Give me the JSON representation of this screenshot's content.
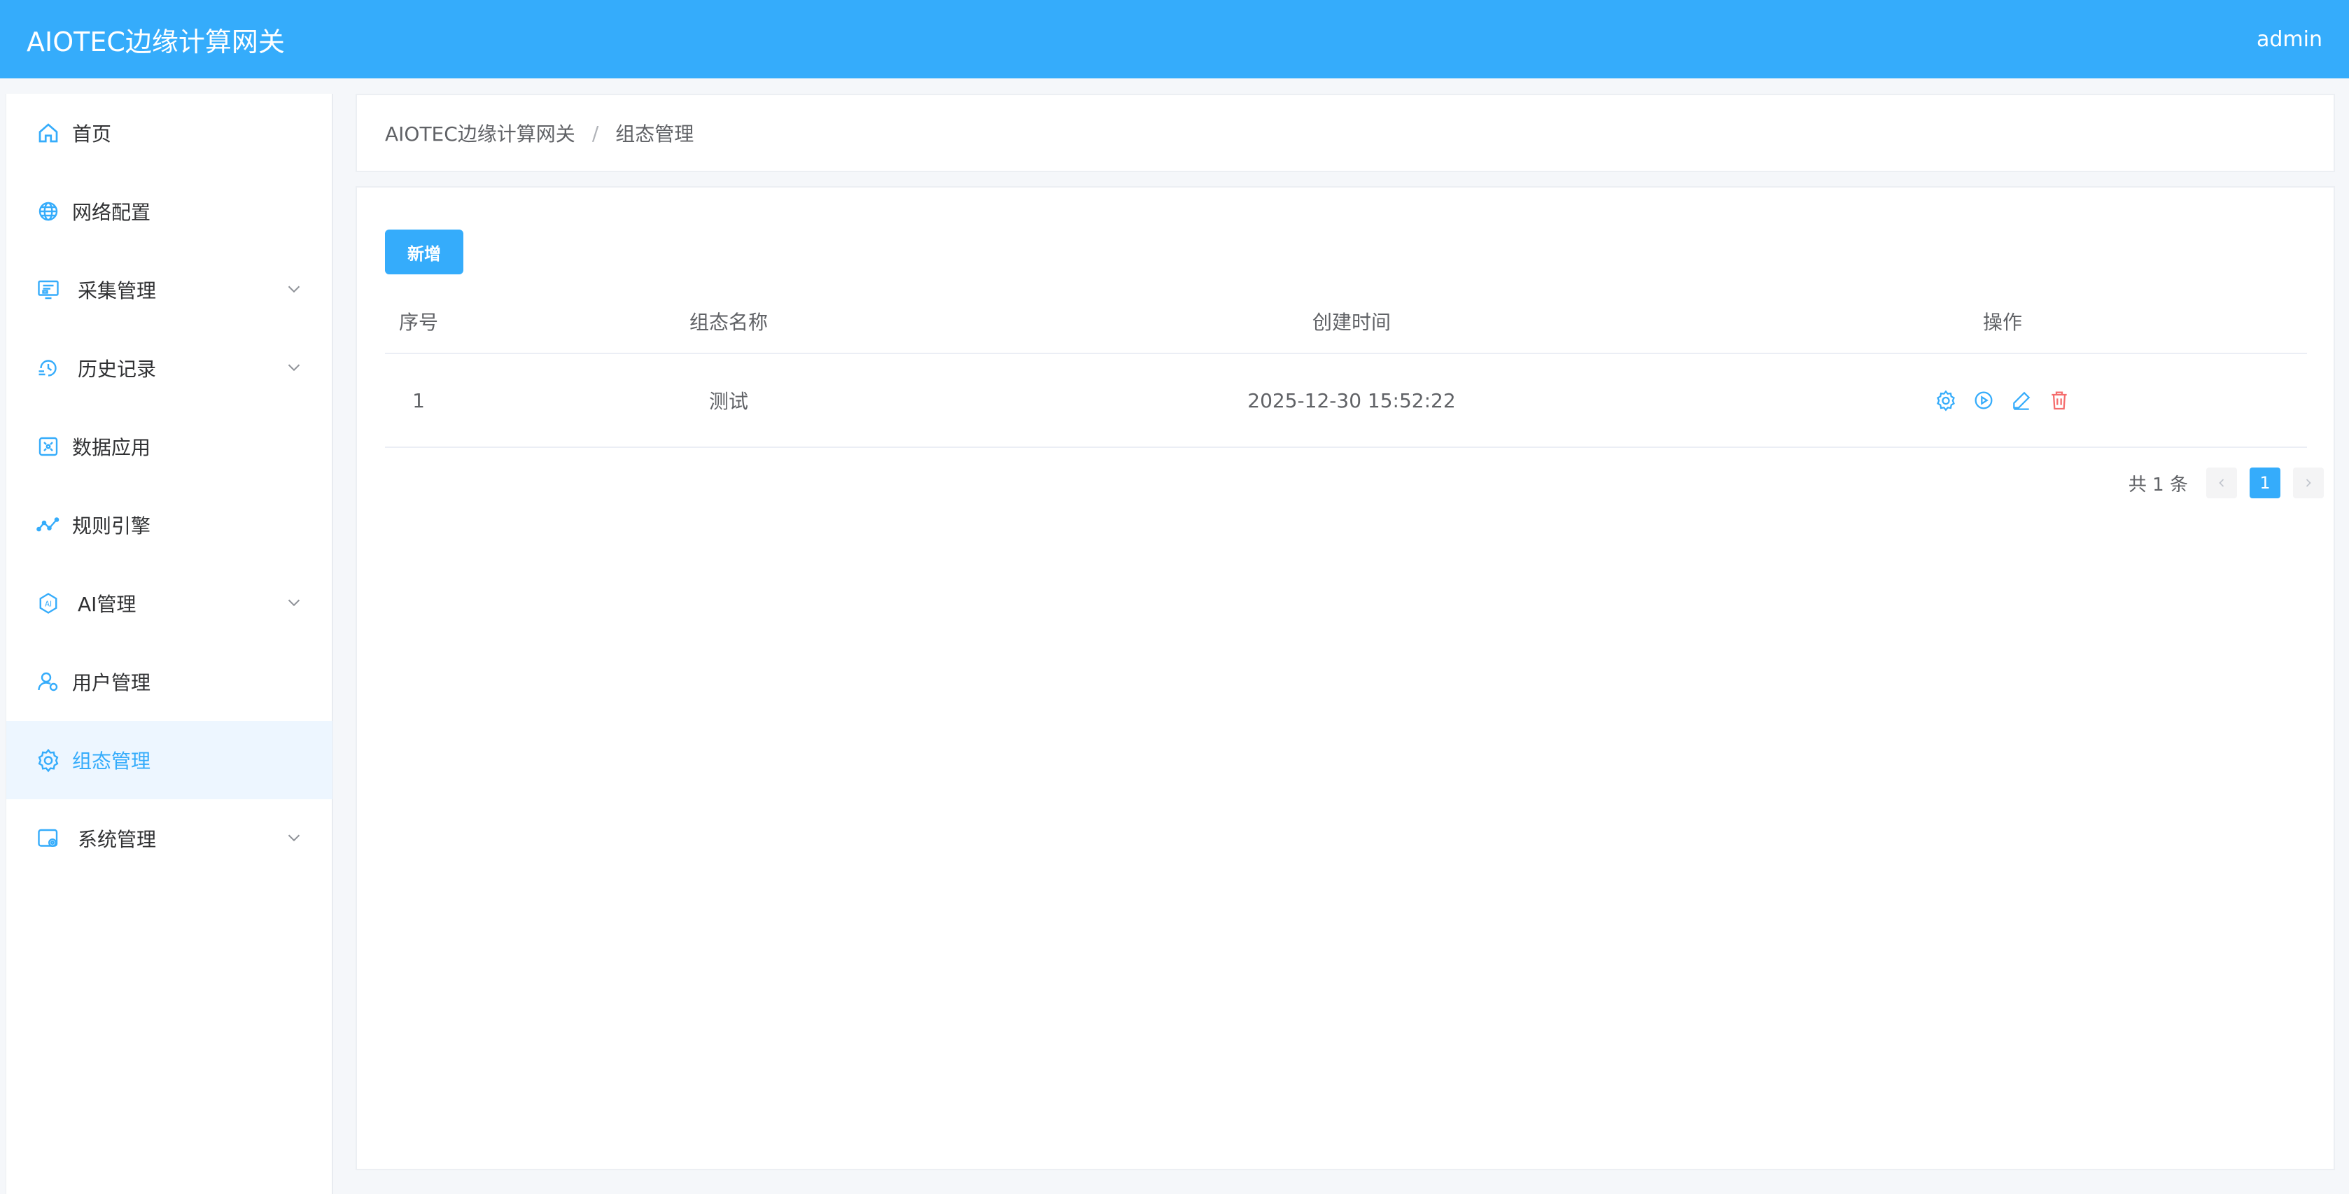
{
  "header": {
    "app_title": "AIOTEC边缘计算网关",
    "user": "admin"
  },
  "sidebar": {
    "items": [
      {
        "label": "首页",
        "icon": "home-icon",
        "expandable": false
      },
      {
        "label": "网络配置",
        "icon": "globe-icon",
        "expandable": false
      },
      {
        "label": "采集管理",
        "icon": "monitor-icon",
        "expandable": true
      },
      {
        "label": "历史记录",
        "icon": "history-icon",
        "expandable": true
      },
      {
        "label": "数据应用",
        "icon": "data-app-icon",
        "expandable": false
      },
      {
        "label": "规则引擎",
        "icon": "rule-graph-icon",
        "expandable": false
      },
      {
        "label": "AI管理",
        "icon": "ai-icon",
        "expandable": true
      },
      {
        "label": "用户管理",
        "icon": "user-icon",
        "expandable": false
      },
      {
        "label": "组态管理",
        "icon": "gear-icon",
        "expandable": false,
        "active": true
      },
      {
        "label": "系统管理",
        "icon": "system-icon",
        "expandable": true
      }
    ]
  },
  "breadcrumb": {
    "root": "AIOTEC边缘计算网关",
    "separator": "/",
    "current": "组态管理"
  },
  "toolbar": {
    "add_label": "新增"
  },
  "table": {
    "columns": [
      "序号",
      "组态名称",
      "创建时间",
      "操作"
    ],
    "rows": [
      {
        "index": "1",
        "name": "测试",
        "created": "2025-12-30 15:52:22"
      }
    ],
    "actions": [
      "config-icon",
      "play-icon",
      "edit-icon",
      "delete-icon"
    ]
  },
  "pagination": {
    "total_text": "共 1 条",
    "current_page": "1"
  },
  "colors": {
    "primary": "#35acfb",
    "danger": "#f56c6c",
    "active_bg": "#edf6ff"
  }
}
